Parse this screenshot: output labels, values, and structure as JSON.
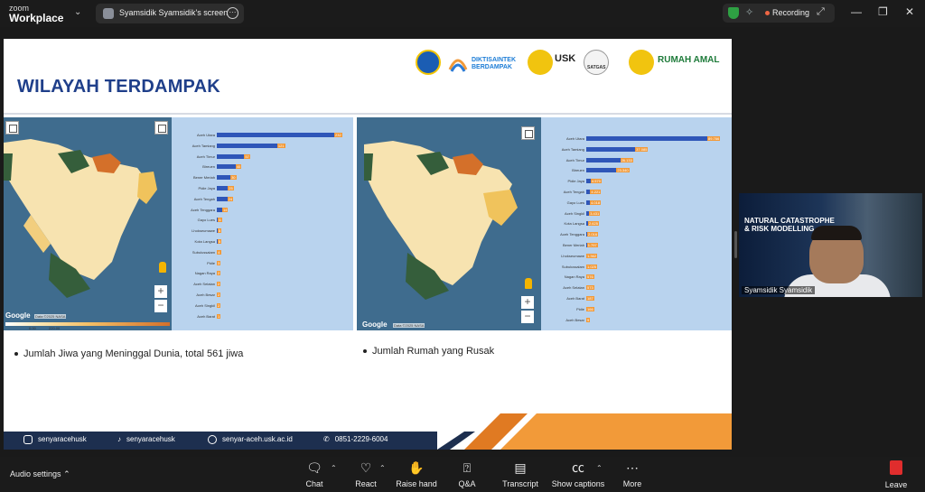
{
  "app": {
    "logo_line1": "zoom",
    "logo_line2": "Workplace"
  },
  "screen_tab": {
    "title": "Syamsidik Syamsidik's screen"
  },
  "recording": {
    "label": "Recording"
  },
  "slide": {
    "title": "WILAYAH TERDAMPAK",
    "logos": [
      {
        "name": "Tut Wuri Handayani",
        "text": ""
      },
      {
        "name": "Diktisaintek Berdampak",
        "text": "DIKTISAINTEK BERDAMPAK"
      },
      {
        "name": "USK",
        "text": "USK"
      },
      {
        "name": "Satgas",
        "text": "SATGAS"
      },
      {
        "name": "Rumah Amal",
        "text": "RUMAH AMAL"
      }
    ],
    "left_panel": {
      "google_label": "Google",
      "attribution": "Data ©2025 NASA",
      "legend_min": "0.00",
      "legend_max": "220.00",
      "bullet": "Jumlah Jiwa yang Meninggal Dunia, total 561 jiwa",
      "chart_data": {
        "type": "bar",
        "orientation": "horizontal",
        "categories": [
          "Aceh Utara",
          "Aceh Tamiang",
          "Aceh Timur",
          "Bireuen",
          "Bener Meriah",
          "Pidie Jaya",
          "Aceh Tengah",
          "Aceh Tenggara",
          "Gayo Lues",
          "Lhokseumawe",
          "Kota Langsa",
          "Subulussalam",
          "Pidie",
          "Nagan Raya",
          "Aceh Selatan",
          "Aceh Besar",
          "Aceh Singkil",
          "Aceh Barat"
        ],
        "values": [
          232,
          121,
          57,
          40,
          30,
          25,
          24,
          14,
          6,
          5,
          5,
          4,
          3,
          2,
          2,
          2,
          2,
          1
        ],
        "labels": [
          "232",
          "121",
          "57",
          "40",
          "30",
          "25",
          "24",
          "14",
          "6",
          "5",
          "5",
          "4",
          "3",
          "2",
          "2",
          "2",
          "2",
          "1"
        ]
      }
    },
    "right_panel": {
      "google_label": "Google",
      "attribution": "Data ©2025 NASA",
      "bullet": "Jumlah Rumah yang Rusak",
      "chart_data": {
        "type": "bar",
        "orientation": "horizontal",
        "categories": [
          "Aceh Utara",
          "Aceh Tamiang",
          "Aceh Timur",
          "Bireuen",
          "Pidie Jaya",
          "Aceh Tengah",
          "Gayo Lues",
          "Aceh Singkil",
          "Kota Langsa",
          "Aceh Tenggara",
          "Bener Meriah",
          "Lhokseumawe",
          "Subulussalam",
          "Nagan Raya",
          "Aceh Selatan",
          "Aceh Barat",
          "Pidie",
          "Aceh Besar"
        ],
        "values": [
          89766,
          37085,
          26133,
          23340,
          4570,
          4221,
          4018,
          3431,
          2625,
          2016,
          1797,
          1362,
          1025,
          576,
          573,
          187,
          166,
          9
        ],
        "labels": [
          "89.766",
          "37.085",
          "26.133",
          "23.340",
          "4.570",
          "4.221",
          "4.018",
          "3.431",
          "2.625",
          "2.016",
          "1.797",
          "1.362",
          "1.025",
          "576",
          "573",
          "187",
          "166",
          "9"
        ]
      }
    },
    "footer": {
      "instagram": "senyaracehusk",
      "tiktok": "senyaracehusk",
      "website": "senyar-aceh.usk.ac.id",
      "phone": "0851-2229-6004"
    }
  },
  "video": {
    "participant": "Syamsidik Syamsidik",
    "headline_1": "NATURAL CATASTROPHE",
    "headline_2": "& RISK MODELLING"
  },
  "toolbar": {
    "audio_settings": "Audio settings",
    "chat": "Chat",
    "react": "React",
    "raise_hand": "Raise hand",
    "qa": "Q&A",
    "transcript": "Transcript",
    "show_captions": "Show captions",
    "more": "More",
    "leave": "Leave"
  },
  "colors": {
    "accent_blue": "#2f56b8",
    "value_orange": "#f29a39",
    "title_blue": "#1f3f8a",
    "leave_red": "#e02d2d"
  }
}
